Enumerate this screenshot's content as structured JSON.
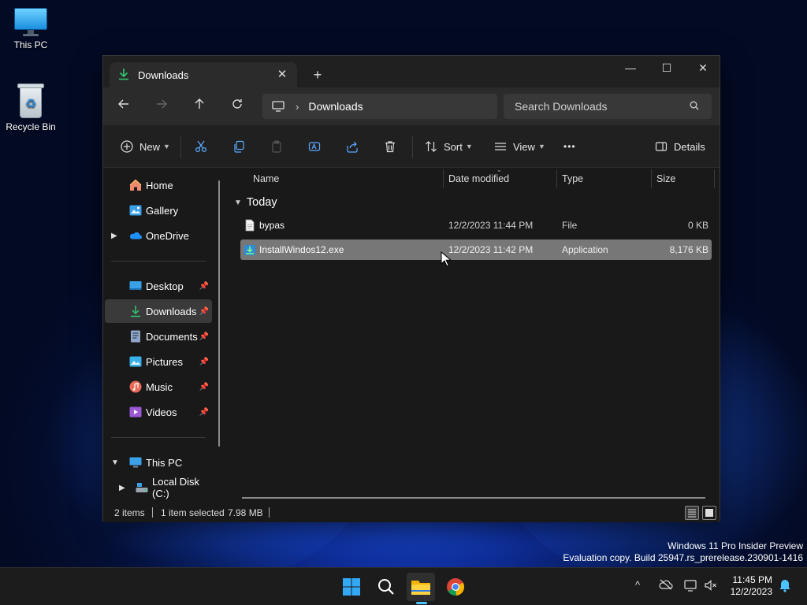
{
  "desktop": {
    "icons": [
      {
        "label": "This PC",
        "icon": "monitor-icon"
      },
      {
        "label": "Recycle Bin",
        "icon": "recycle-bin-icon"
      }
    ],
    "watermark": {
      "line1": "Windows 11 Pro Insider Preview",
      "line2": "Evaluation copy. Build 25947.rs_prerelease.230901-1416"
    }
  },
  "window": {
    "tab_title": "Downloads",
    "tab_close": "✕",
    "new_tab": "+",
    "controls": {
      "minimize": "—",
      "maximize": "☐",
      "close": "✕"
    },
    "address": {
      "location": "Downloads",
      "separator": "›"
    },
    "search": {
      "placeholder": "Search Downloads"
    },
    "command_bar": {
      "new_label": "New",
      "sort_label": "Sort",
      "view_label": "View",
      "more_label": "•••",
      "details_label": "Details"
    },
    "sidebar": {
      "quick": [
        {
          "label": "Home",
          "icon": "home-icon"
        },
        {
          "label": "Gallery",
          "icon": "gallery-icon"
        },
        {
          "label": "OneDrive",
          "icon": "onedrive-icon"
        }
      ],
      "pinned": [
        {
          "label": "Desktop",
          "icon": "desktop-folder-icon"
        },
        {
          "label": "Downloads",
          "icon": "downloads-folder-icon",
          "selected": true
        },
        {
          "label": "Documents",
          "icon": "documents-folder-icon"
        },
        {
          "label": "Pictures",
          "icon": "pictures-folder-icon"
        },
        {
          "label": "Music",
          "icon": "music-folder-icon"
        },
        {
          "label": "Videos",
          "icon": "videos-folder-icon"
        }
      ],
      "this_pc": {
        "label": "This PC"
      },
      "local_disk": {
        "label": "Local Disk (C:)"
      }
    },
    "columns": {
      "name": "Name",
      "date": "Date modified",
      "type": "Type",
      "size": "Size"
    },
    "group": "Today",
    "files": [
      {
        "name": "bypas",
        "date": "12/2/2023 11:44 PM",
        "type": "File",
        "size": "0 KB",
        "selected": false
      },
      {
        "name": "InstallWindos12.exe",
        "date": "12/2/2023 11:42 PM",
        "type": "Application",
        "size": "8,176 KB",
        "selected": true
      }
    ],
    "status": {
      "items": "2 items",
      "selected": "1 item selected",
      "size": "7.98 MB"
    }
  },
  "taskbar": {
    "clock_time": "11:45 PM",
    "clock_date": "12/2/2023",
    "tray_overflow": "^"
  },
  "colors": {
    "accent": "#4cc2ff",
    "window_bg": "#191919",
    "selection": "#777777",
    "download_green": "#2ecc71"
  }
}
